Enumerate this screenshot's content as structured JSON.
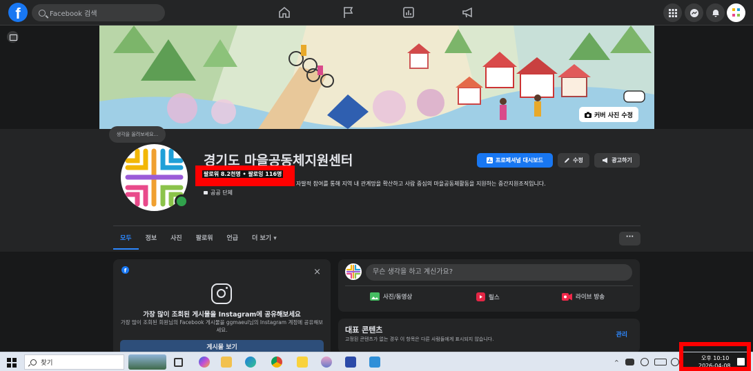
{
  "topbar": {
    "logo": "f",
    "search_placeholder": "Facebook 검색",
    "nav_icons": [
      "home-icon",
      "flag-icon",
      "dashboard-icon",
      "megaphone-icon"
    ],
    "right_icons": [
      "menu-grid-icon",
      "messenger-icon",
      "bell-icon",
      "account-icon"
    ]
  },
  "cover": {
    "edit_label": "커버 사진 수정"
  },
  "tooltip": "생각을 올려보세요...",
  "profile": {
    "name": "경기도 마을공동체지원센터",
    "followers": "팔로워 8.2천명 • 팔로잉 116명",
    "description": "자발적 참여를 통해 지역 내 관계망을 확산하고 사람 중심의 마을공동체활동을 지원하는 중간지원조직입니다.",
    "category": "공공 단체"
  },
  "actions": {
    "dashboard": "프로페셔널 대시보드",
    "edit": "수정",
    "advertise": "광고하기"
  },
  "tabs": [
    {
      "label": "모두",
      "active": true
    },
    {
      "label": "정보"
    },
    {
      "label": "사진"
    },
    {
      "label": "팔로워"
    },
    {
      "label": "언급"
    },
    {
      "label": "더 보기 ▾"
    }
  ],
  "more_button": "···",
  "instagram_card": {
    "title": "가장 많이 조회된 게시물을 Instagram에 공유해보세요",
    "subtitle": "가장 많이 조회된 회원님의 Facebook 게시물을 ggmaeul님의 Instagram 계정에 공유해보세요.",
    "button": "게시물 보기",
    "close": "×"
  },
  "composer": {
    "placeholder": "무슨 생각을 하고 계신가요?",
    "actions": [
      "사진/동영상",
      "릴스",
      "라이브 방송"
    ]
  },
  "featured": {
    "title": "대표 콘텐츠",
    "subtitle": "고정된 콘텐츠가 없는 경우 이 항목은 다른 사람들에게 표시되지 않습니다.",
    "manage": "관리"
  },
  "taskbar": {
    "search_placeholder": "찾기",
    "time": "오후 10:10",
    "date": "2026-04-08"
  },
  "colors": {
    "accent": "#1877f2",
    "highlight": "#ff0000",
    "background": "#18191a",
    "surface": "#242526"
  }
}
